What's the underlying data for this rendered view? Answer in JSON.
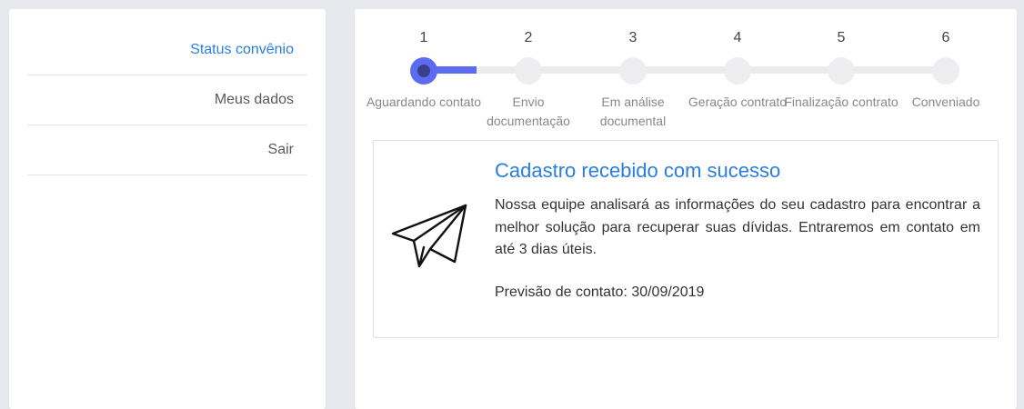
{
  "sidebar": {
    "items": [
      {
        "label": "Status convênio",
        "active": true
      },
      {
        "label": "Meus dados",
        "active": false
      },
      {
        "label": "Sair",
        "active": false
      }
    ]
  },
  "stepper": {
    "progress_fraction": 0.1,
    "steps": [
      {
        "number": "1",
        "label": "Aguardando contato",
        "active": true
      },
      {
        "number": "2",
        "label": "Envio documentação",
        "active": false
      },
      {
        "number": "3",
        "label": "Em análise documental",
        "active": false
      },
      {
        "number": "4",
        "label": "Geração contrato",
        "active": false
      },
      {
        "number": "5",
        "label": "Finalização contrato",
        "active": false
      },
      {
        "number": "6",
        "label": "Conveniado",
        "active": false
      }
    ]
  },
  "card": {
    "icon": "paper-plane-icon",
    "title": "Cadastro recebido com sucesso",
    "text": "Nossa equipe analisará as informações do seu cadastro para encontrar a melhor solução para recuperar suas dívidas. Entraremos em contato em até 3 dias úteis.",
    "forecast": "Previsão de contato: 30/09/2019"
  },
  "colors": {
    "accent": "#2a7de1",
    "stepper_active": "#5b6cf2",
    "background": "#e8e9ee"
  }
}
